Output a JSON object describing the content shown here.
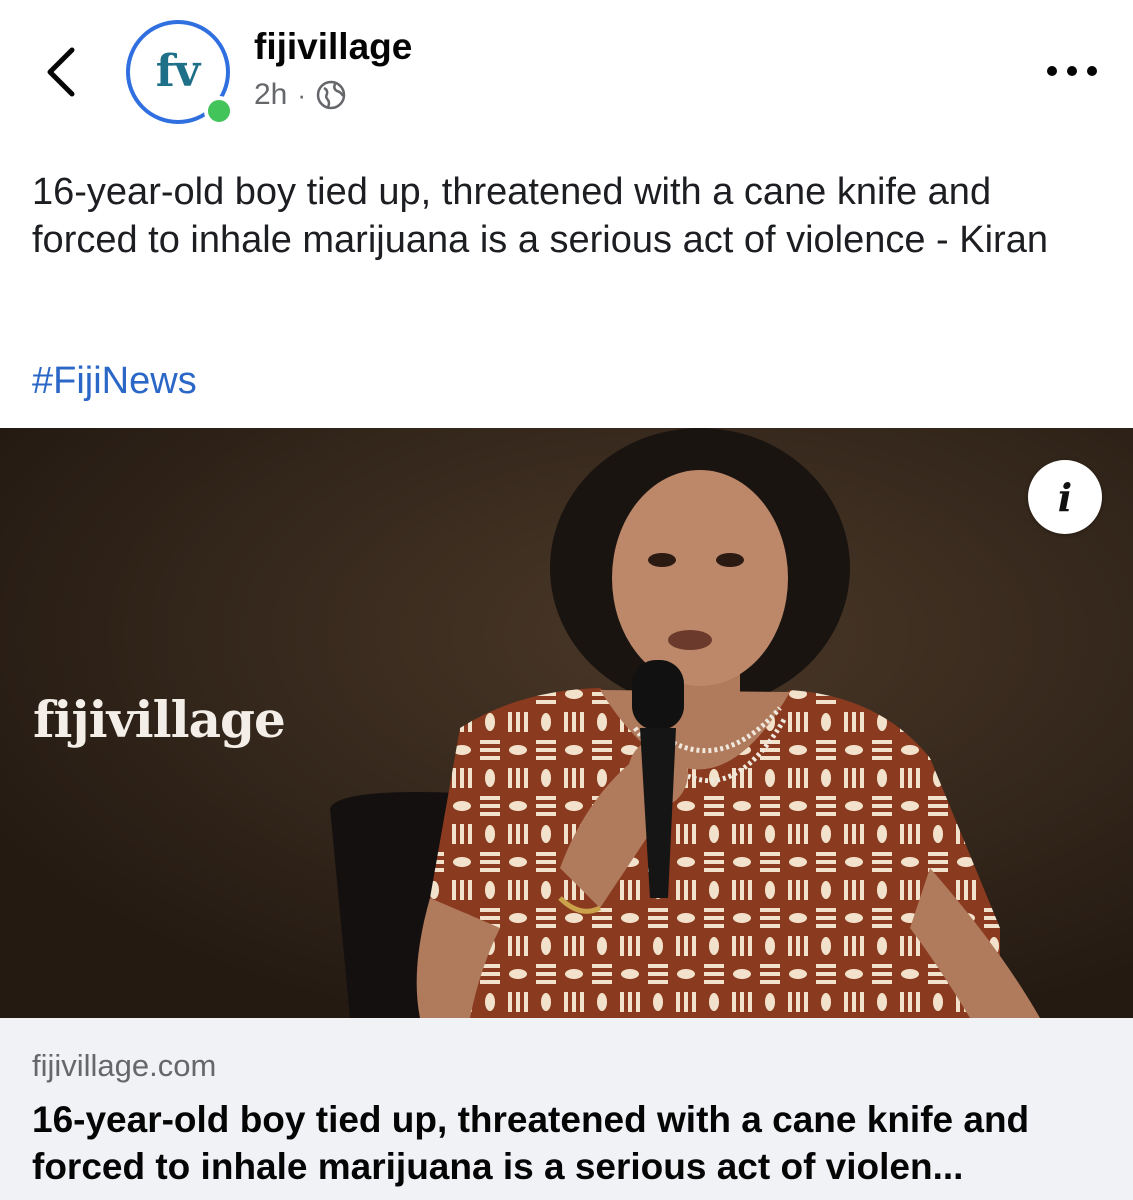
{
  "header": {
    "page_name": "fijivillage",
    "time": "2h",
    "separator": "·",
    "avatar_letters": "fv"
  },
  "post": {
    "text": "16-year-old boy tied up, threatened with a cane knife and forced to inhale marijuana is a serious act of violence - Kiran",
    "hashtag": "#FijiNews"
  },
  "image": {
    "watermark": "fijivillage",
    "info_glyph": "i"
  },
  "link_preview": {
    "domain": "fijivillage.com",
    "title": "16-year-old boy tied up, threatened with a cane knife and forced to inhale marijuana is a serious act of violen..."
  },
  "colors": {
    "accent_blue": "#2b67c6",
    "avatar_ring": "#2f6fe0",
    "online_green": "#43c45a",
    "muted_text": "#65676b",
    "link_bg": "#f0f2f5"
  },
  "icons": [
    "back-chevron-icon",
    "globe-icon",
    "more-icon",
    "info-icon"
  ]
}
